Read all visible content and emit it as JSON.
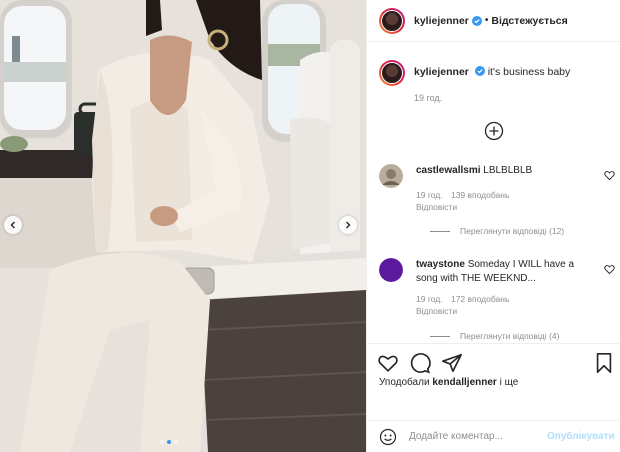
{
  "post": {
    "username": "kyliejenner",
    "follow_status": "Відстежується",
    "separator": "•",
    "caption": "it's business baby",
    "caption_time": "19 год."
  },
  "comments": [
    {
      "username": "castlewallsmi",
      "text": "LBLBLBLB",
      "time": "19 год.",
      "likes": "139 вподобань",
      "reply": "Відповісти",
      "view_replies": "Переглянути відповіді (12)"
    },
    {
      "username": "twaystone",
      "text": "Someday I WILL have a song with THE WEEKND...",
      "time": "19 год.",
      "likes": "172 вподобань",
      "reply": "Відповісти",
      "view_replies": "Переглянути відповіді (4)"
    }
  ],
  "likes": {
    "prefix": "Уподобали",
    "user": "kendalljenner",
    "suffix": "і ще"
  },
  "comment_box": {
    "placeholder": "Додайте коментар...",
    "post_label": "Опублікувати"
  },
  "carousel": {
    "slides": 3,
    "active": 1
  },
  "colors": {
    "accent": "#3897f0",
    "verified": "#3897f0",
    "post_disabled": "#b2dffc"
  },
  "icons": [
    "chevron-left-icon",
    "chevron-right-icon",
    "verified-icon",
    "plus-circle-icon",
    "heart-icon",
    "comment-icon",
    "share-icon",
    "bookmark-icon",
    "emoji-icon"
  ]
}
